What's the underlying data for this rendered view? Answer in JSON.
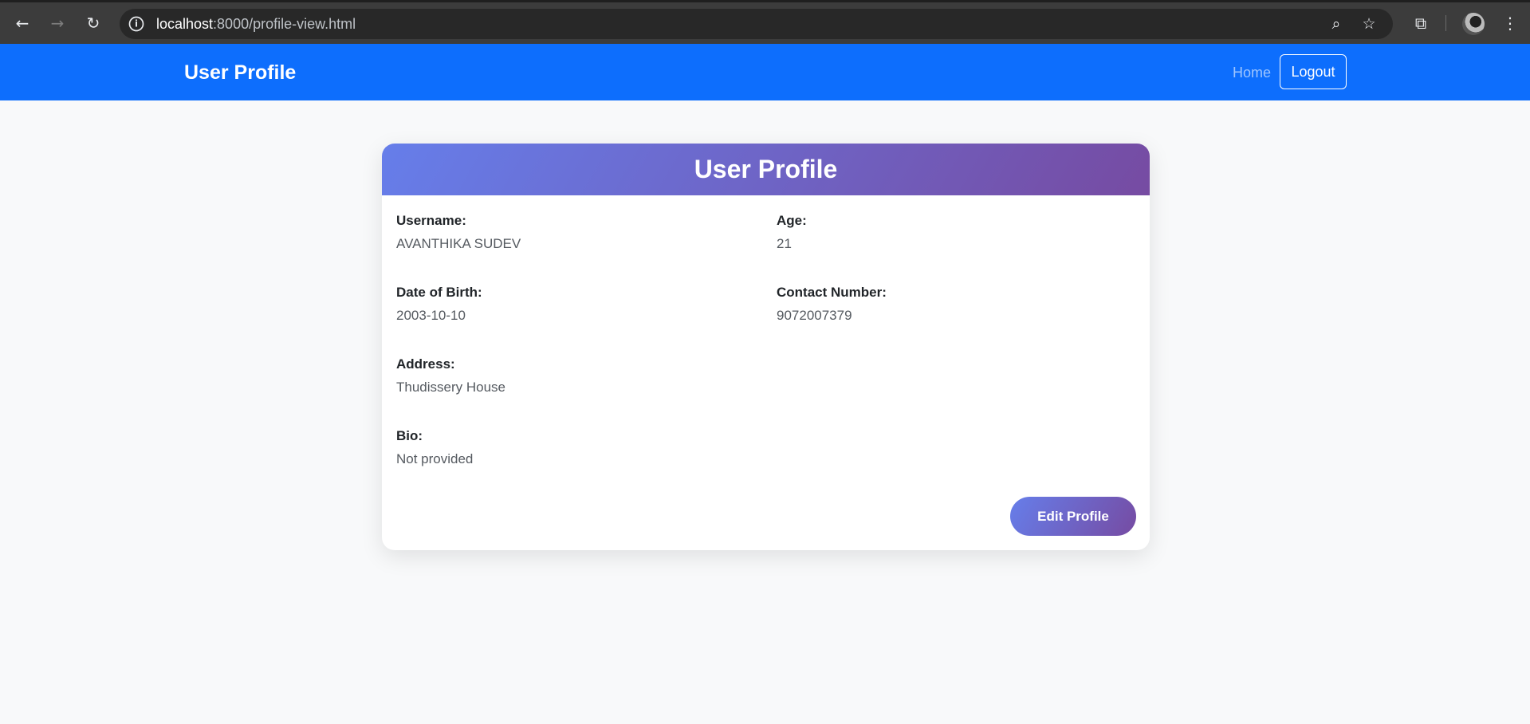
{
  "browser": {
    "url_host": "localhost",
    "url_path": ":8000/profile-view.html",
    "icons": [
      "back-icon",
      "forward-icon",
      "reload-icon",
      "site-info-icon",
      "zoom-icon",
      "star-icon",
      "extensions-icon",
      "profile-avatar",
      "menu-icon"
    ]
  },
  "navbar": {
    "brand": "User Profile",
    "home_link": "Home",
    "logout_label": "Logout",
    "background_color": "#0d6efd"
  },
  "card": {
    "title": "User Profile",
    "fields": [
      {
        "label": "Username:",
        "value": "AVANTHIKA SUDEV"
      },
      {
        "label": "Age:",
        "value": "21"
      },
      {
        "label": "Date of Birth:",
        "value": "2003-10-10"
      },
      {
        "label": "Contact Number:",
        "value": "9072007379"
      },
      {
        "label": "Address:",
        "value": "Thudissery House"
      },
      {
        "label": "Bio:",
        "value": "Not provided"
      }
    ],
    "edit_button_label": "Edit Profile",
    "gradient_start": "#667eea",
    "gradient_end": "#764ba2"
  }
}
